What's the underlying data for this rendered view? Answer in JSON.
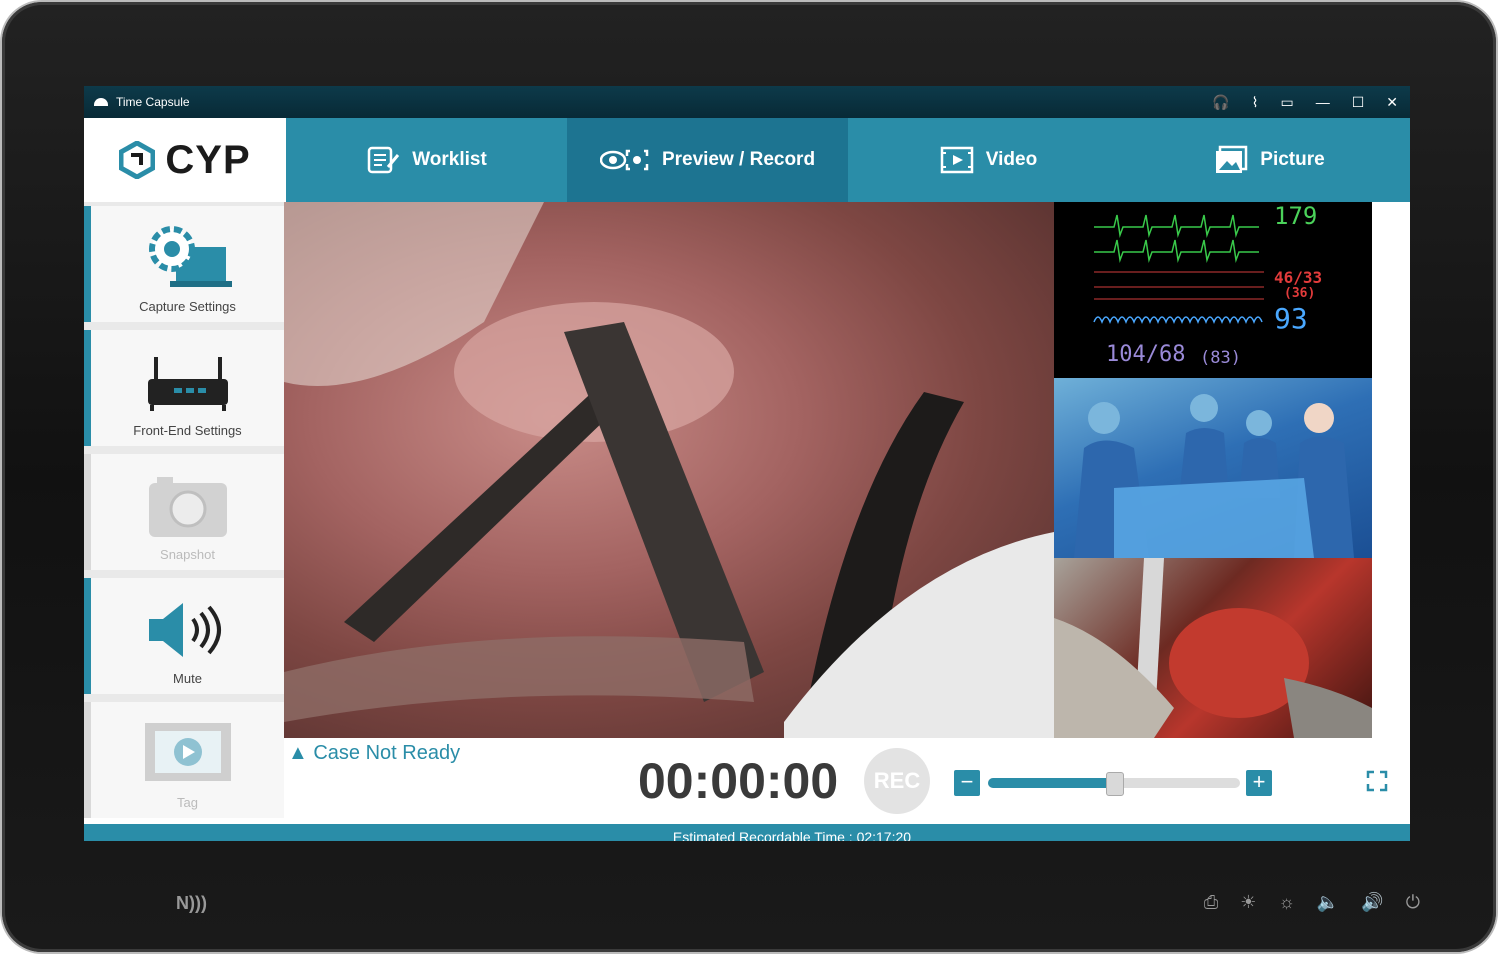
{
  "window": {
    "title": "Time Capsule"
  },
  "brand": {
    "logo_text": "CYP"
  },
  "nav": {
    "tabs": [
      {
        "label": "Worklist",
        "icon": "worklist-icon"
      },
      {
        "label": "Preview / Record",
        "icon": "preview-record-icon",
        "active": true
      },
      {
        "label": "Video",
        "icon": "video-icon"
      },
      {
        "label": "Picture",
        "icon": "picture-icon"
      }
    ]
  },
  "sidebar": {
    "items": [
      {
        "label": "Capture Settings",
        "icon": "capture-settings-icon"
      },
      {
        "label": "Front-End Settings",
        "icon": "router-icon"
      },
      {
        "label": "Snapshot",
        "icon": "camera-icon",
        "disabled": true
      },
      {
        "label": "Mute",
        "icon": "speaker-icon"
      },
      {
        "label": "Tag",
        "icon": "tag-video-icon",
        "disabled": true
      }
    ]
  },
  "monitor": {
    "hr": "179",
    "art": "46/33",
    "art_mean": "(36)",
    "spo2": "93",
    "nibp": "104/68",
    "nibp_mean": "(83)"
  },
  "controls": {
    "case_status": "Case Not Ready",
    "timer": "00:00:00",
    "rec_label": "REC",
    "zoom_level": 0.5
  },
  "footer": {
    "estimated_label": "Estimated Recordable Time :",
    "estimated_value": "02:17:20"
  },
  "colors": {
    "accent": "#2a8da8",
    "active_tab": "#1d7491"
  }
}
